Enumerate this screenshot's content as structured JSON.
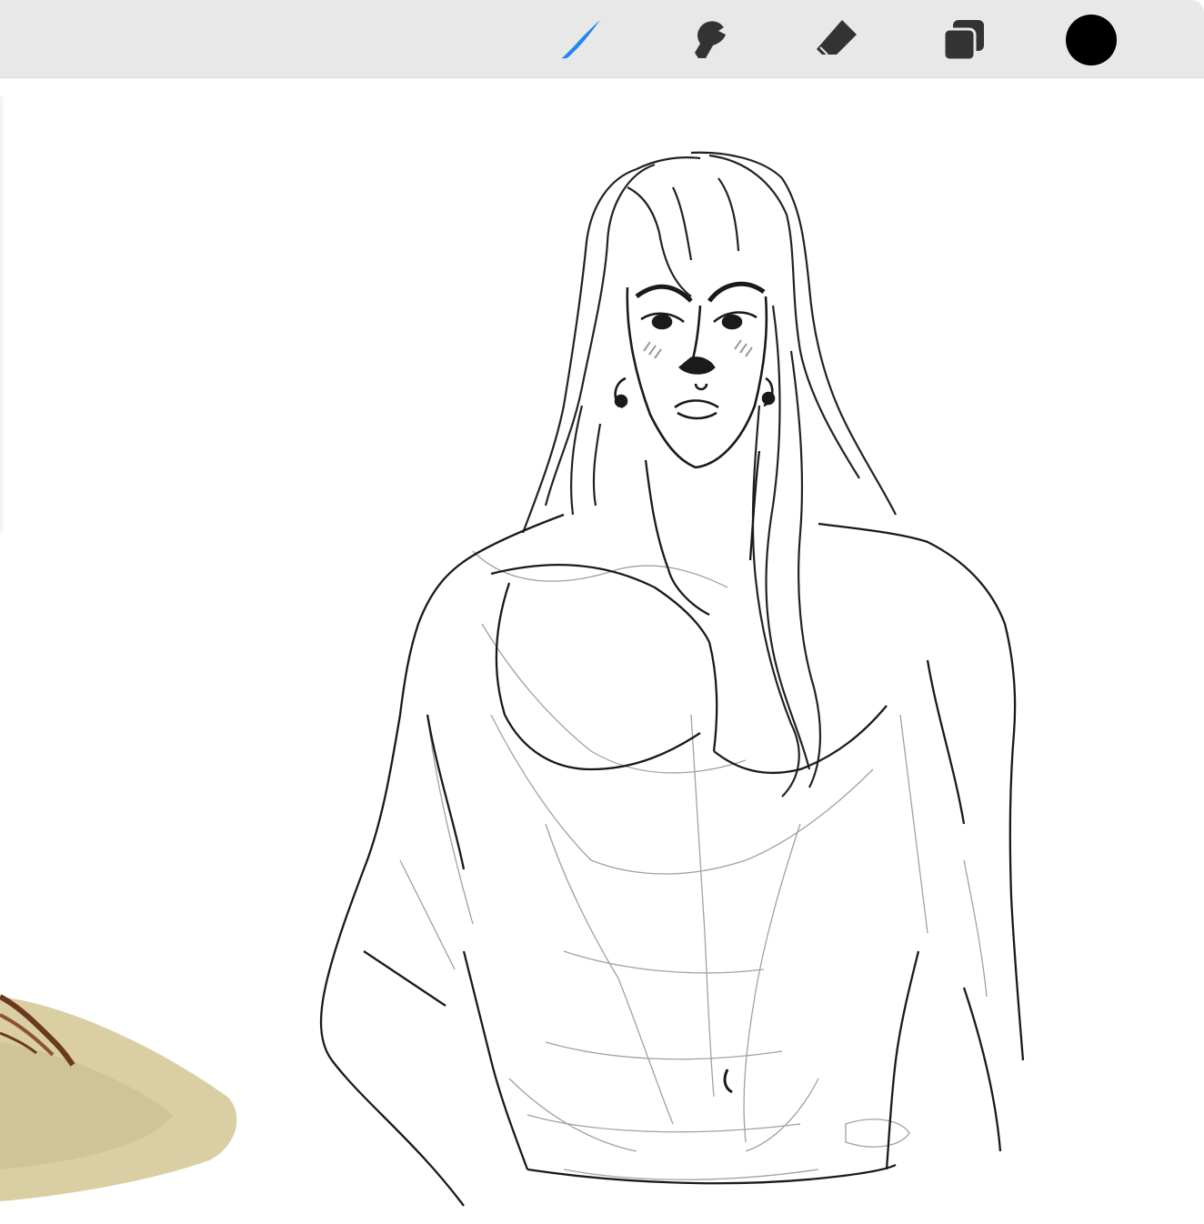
{
  "app": {
    "name": "drawing-canvas"
  },
  "toolbar": {
    "tools": [
      {
        "id": "brush",
        "icon": "brush-icon",
        "active": true,
        "color": "#1e88f0"
      },
      {
        "id": "smudge",
        "icon": "smudge-icon",
        "active": false,
        "color": "#333333"
      },
      {
        "id": "eraser",
        "icon": "eraser-icon",
        "active": false,
        "color": "#333333"
      },
      {
        "id": "layers",
        "icon": "layers-icon",
        "active": false,
        "color": "#333333"
      }
    ],
    "current_color": "#000000"
  },
  "canvas": {
    "background": "#ffffff",
    "stroke_color": "#222222",
    "sketch_color": "#8a8a8a",
    "ground_color": "#d9cfa3",
    "blush_color": "#9a9a9a"
  }
}
